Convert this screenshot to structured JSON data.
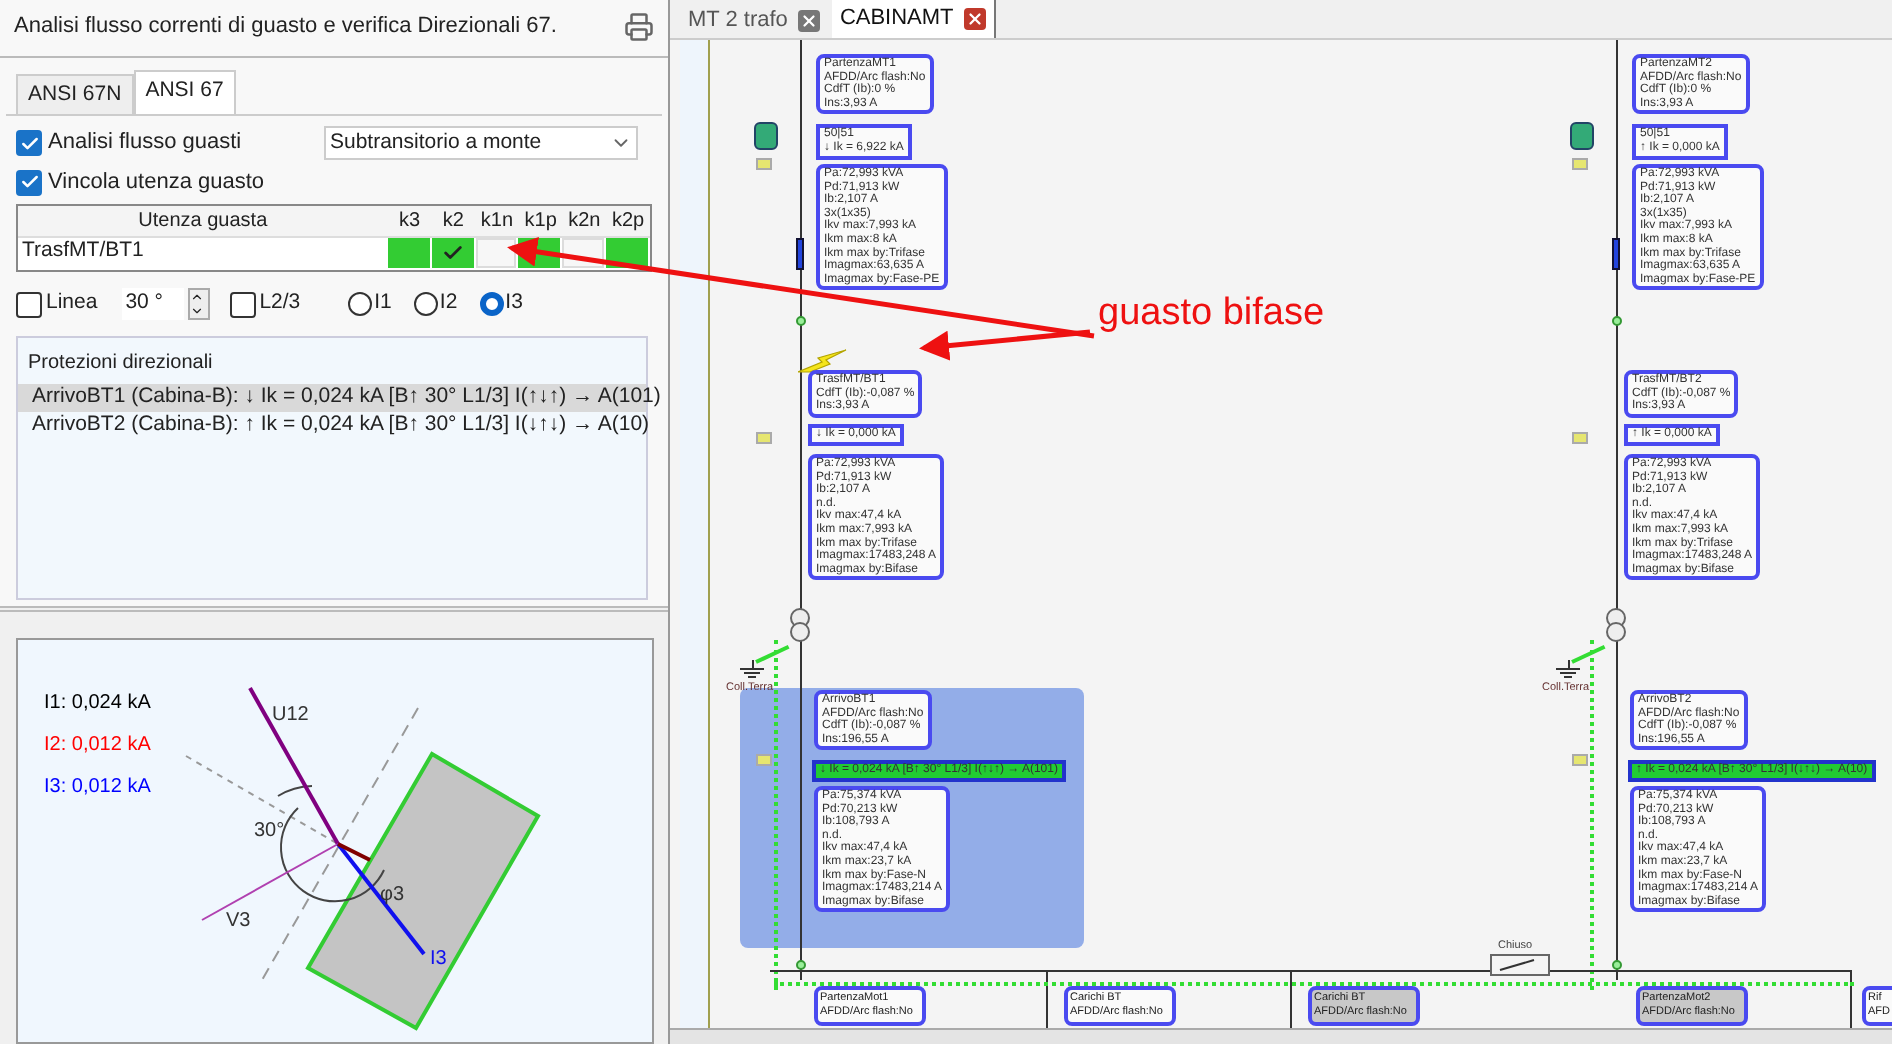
{
  "left_panel": {
    "title": "Analisi flusso correnti di guasto e verifica Direzionali 67.",
    "tabs": [
      {
        "label": "ANSI 67N",
        "selected": false
      },
      {
        "label": "ANSI 67",
        "selected": true
      }
    ],
    "options": [
      {
        "label": "Analisi flusso guasti",
        "checked": true
      },
      {
        "label": "Vincola utenza guasto",
        "checked": true
      }
    ],
    "mode_select": {
      "value": "Subtransitorio a monte"
    },
    "fault_table": {
      "columns": [
        "Utenza guasta",
        "k3",
        "k2",
        "k1n",
        "k1p",
        "k2n",
        "k2p"
      ],
      "rows": [
        {
          "name": "TrasfMT/BT1",
          "cells": [
            {
              "enabled": true,
              "checked": false
            },
            {
              "enabled": true,
              "checked": true
            },
            {
              "enabled": false,
              "checked": false
            },
            {
              "enabled": true,
              "checked": false
            },
            {
              "enabled": false,
              "checked": false
            },
            {
              "enabled": true,
              "checked": false
            }
          ]
        }
      ]
    },
    "line_option": {
      "label": "Linea",
      "checked": false
    },
    "angle": {
      "value": "30 °"
    },
    "l23_option": {
      "label": "L2/3",
      "checked": false
    },
    "current_radios": [
      {
        "label": "I1",
        "selected": false
      },
      {
        "label": "I2",
        "selected": false
      },
      {
        "label": "I3",
        "selected": true
      }
    ],
    "protections": {
      "title": "Protezioni direzionali",
      "items": [
        {
          "text": "ArrivoBT1 (Cabina-B): ↓ Ik = 0,024 kA [B↑ 30° L1/3] I(↑↓↑) → A(101)",
          "selected": true
        },
        {
          "text": "ArrivoBT2 (Cabina-B): ↑ Ik = 0,024 kA [B↑ 30° L1/3] I(↓↑↓) → A(10)",
          "selected": false
        }
      ]
    },
    "phasor": {
      "readings": [
        {
          "text": "I1: 0,024 kA",
          "color": "#000000"
        },
        {
          "text": "I2: 0,012 kA",
          "color": "#ff0000"
        },
        {
          "text": "I3: 0,012 kA",
          "color": "#0000ff"
        }
      ],
      "labels": {
        "voltage": "U12",
        "angle": "30°",
        "phase_voltage": "V3",
        "phi": "φ3",
        "current": "I3"
      }
    }
  },
  "diagram": {
    "tabs": [
      {
        "label": "MT 2 trafo",
        "selected": false
      },
      {
        "label": "CABINAMT",
        "selected": true
      }
    ],
    "annotation": "guasto bifase",
    "feeders": [
      {
        "highlighted": true,
        "fault": true,
        "ground_label": "Coll.Terra",
        "boxes": [
          {
            "kind": "info",
            "lines": [
              "PartenzaMT1",
              "AFDD/Arc flash:No",
              "CdfT (Ib):0 %",
              "Ins:3,93 A"
            ]
          },
          {
            "kind": "current",
            "lines": [
              "50|51",
              "↓ Ik = 6,922 kA"
            ]
          },
          {
            "kind": "info",
            "lines": [
              "Pa:72,993 kVA",
              "Pd:71,913 kW",
              "Ib:2,107 A",
              "3x(1x35)",
              "Ikv max:7,993 kA",
              "Ikm max:8 kA",
              "Ikm max by:Trifase",
              "Imagmax:63,635 A",
              "Imagmax by:Fase-PE"
            ]
          },
          {
            "kind": "info",
            "lines": [
              "TrasfMT/BT1",
              "CdfT (Ib):-0,087 %",
              "Ins:3,93 A"
            ]
          },
          {
            "kind": "current",
            "lines": [
              "↓ Ik = 0,000 kA"
            ]
          },
          {
            "kind": "info",
            "lines": [
              "Pa:72,993 kVA",
              "Pd:71,913 kW",
              "Ib:2,107 A",
              "n.d.",
              "Ikv max:47,4 kA",
              "Ikm max:7,993 kA",
              "Ikm max by:Trifase",
              "Imagmax:17483,248 A",
              "Imagmax by:Bifase"
            ]
          },
          {
            "kind": "info",
            "lines": [
              "ArrivoBT1",
              "AFDD/Arc flash:No",
              "CdfT (Ib):-0,087 %",
              "Ins:196,55 A"
            ]
          },
          {
            "kind": "fault",
            "lines": [
              "↓ Ik = 0,024 kA [B↑ 30° L1/3] I(↑↓↑) → A(101)"
            ]
          },
          {
            "kind": "info",
            "lines": [
              "Pa:75,374 kVA",
              "Pd:70,213 kW",
              "Ib:108,793 A",
              "n.d.",
              "Ikv max:47,4 kA",
              "Ikm max:23,7 kA",
              "Ikm max by:Fase-N",
              "Imagmax:17483,214 A",
              "Imagmax by:Bifase"
            ]
          }
        ]
      },
      {
        "highlighted": false,
        "fault": false,
        "ground_label": "Coll.Terra",
        "boxes": [
          {
            "kind": "info",
            "lines": [
              "PartenzaMT2",
              "AFDD/Arc flash:No",
              "CdfT (Ib):0 %",
              "Ins:3,93 A"
            ]
          },
          {
            "kind": "current",
            "lines": [
              "50|51",
              "↑ Ik = 0,000 kA"
            ]
          },
          {
            "kind": "info",
            "lines": [
              "Pa:72,993 kVA",
              "Pd:71,913 kW",
              "Ib:2,107 A",
              "3x(1x35)",
              "Ikv max:7,993 kA",
              "Ikm max:8 kA",
              "Ikm max by:Trifase",
              "Imagmax:63,635 A",
              "Imagmax by:Fase-PE"
            ]
          },
          {
            "kind": "info",
            "lines": [
              "TrasfMT/BT2",
              "CdfT (Ib):-0,087 %",
              "Ins:3,93 A"
            ]
          },
          {
            "kind": "current",
            "lines": [
              "↑ Ik = 0,000 kA"
            ]
          },
          {
            "kind": "info",
            "lines": [
              "Pa:72,993 kVA",
              "Pd:71,913 kW",
              "Ib:2,107 A",
              "n.d.",
              "Ikv max:47,4 kA",
              "Ikm max:7,993 kA",
              "Ikm max by:Trifase",
              "Imagmax:17483,248 A",
              "Imagmax by:Bifase"
            ]
          },
          {
            "kind": "info",
            "lines": [
              "ArrivoBT2",
              "AFDD/Arc flash:No",
              "CdfT (Ib):-0,087 %",
              "Ins:196,55 A"
            ]
          },
          {
            "kind": "fault",
            "lines": [
              "↑ Ik = 0,024 kA [B↑ 30° L1/3] I(↓↑↓) → A(10)"
            ]
          },
          {
            "kind": "info",
            "lines": [
              "Pa:75,374 kVA",
              "Pd:70,213 kW",
              "Ib:108,793 A",
              "n.d.",
              "Ikv max:47,4 kA",
              "Ikm max:23,7 kA",
              "Ikm max by:Fase-N",
              "Imagmax:17483,214 A",
              "Imagmax by:Bifase"
            ]
          }
        ]
      }
    ],
    "switch_label": "Chiuso",
    "bottom_boxes": [
      {
        "lines": [
          "PartenzaMot1",
          "AFDD/Arc flash:No"
        ],
        "selected": false
      },
      {
        "lines": [
          "Carichi BT",
          "AFDD/Arc flash:No"
        ],
        "selected": false
      },
      {
        "lines": [
          "Carichi BT",
          "AFDD/Arc flash:No"
        ],
        "selected": true
      },
      {
        "lines": [
          "PartenzaMot2",
          "AFDD/Arc flash:No"
        ],
        "selected": true
      },
      {
        "lines": [
          "Rif",
          "AFD"
        ],
        "selected": false
      }
    ]
  }
}
